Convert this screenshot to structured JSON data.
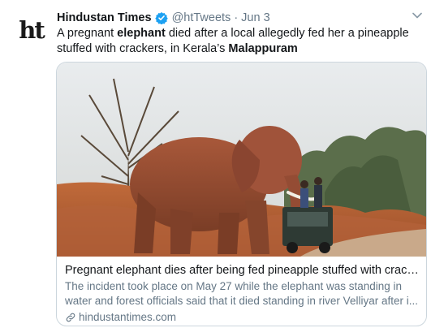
{
  "tweet": {
    "author_name": "Hindustan Times",
    "handle": "@htTweets",
    "separator": "·",
    "date": "Jun 3",
    "avatar_text": "ht",
    "text_segments": [
      {
        "text": "A pregnant ",
        "bold": false
      },
      {
        "text": "elephant",
        "bold": true
      },
      {
        "text": " died after a local allegedly fed her a pineapple stuffed with crackers, in Kerala’s ",
        "bold": false
      },
      {
        "text": "Malappuram",
        "bold": true
      }
    ]
  },
  "card": {
    "title": "Pregnant elephant dies after being fed pineapple stuffed with crackers -...",
    "description": "The incident took place on May 27 while the elephant was standing in water and forest officials said that it died standing in river Velliyar after i...",
    "domain": "hindustantimes.com"
  },
  "colors": {
    "accent": "#1da1f2",
    "secondary_text": "#657786",
    "border": "#ccd6dd"
  },
  "icons": [
    "verified-badge-icon",
    "chevron-down-icon",
    "link-icon"
  ]
}
